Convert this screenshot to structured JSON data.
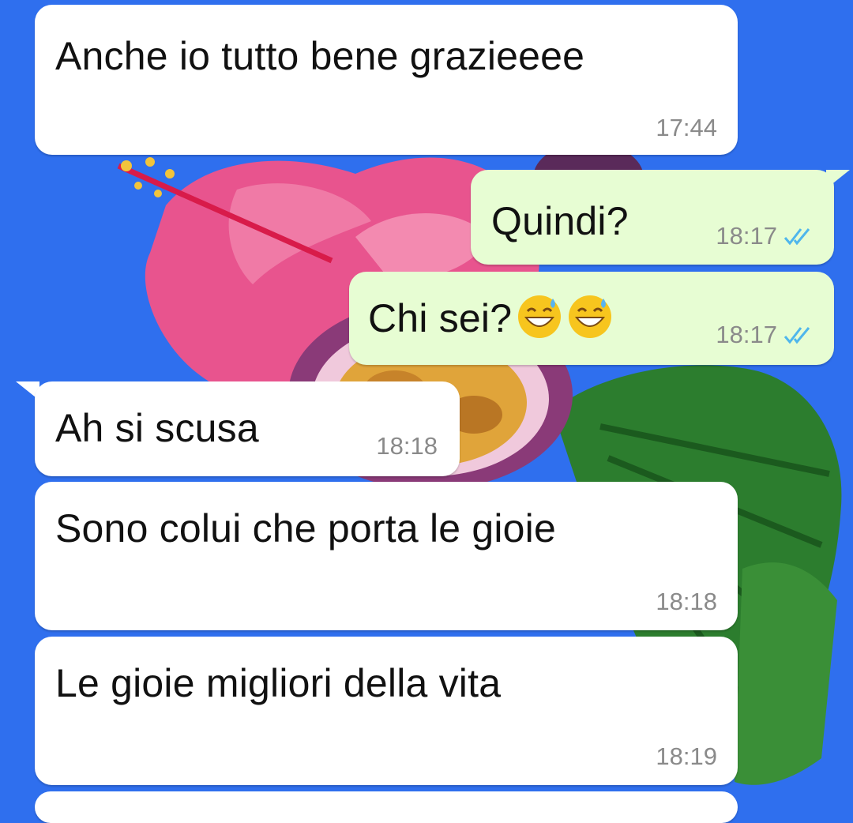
{
  "colors": {
    "wallpaper": "#2f6fee",
    "incoming_bubble": "#ffffff",
    "outgoing_bubble": "#e7fdd3",
    "read_tick": "#4fb6ec",
    "timestamp": "#8a8a8a"
  },
  "messages": [
    {
      "direction": "incoming",
      "text": "Anche io tutto bene grazieeee",
      "time": "17:44"
    },
    {
      "direction": "outgoing",
      "text": "Quindi?",
      "time": "18:17",
      "status": "read",
      "status_icon": "double-check-icon"
    },
    {
      "direction": "outgoing",
      "text": "Chi sei?",
      "emoji": [
        "grinning-sweat-emoji",
        "grinning-sweat-emoji"
      ],
      "time": "18:17",
      "status": "read",
      "status_icon": "double-check-icon"
    },
    {
      "direction": "incoming",
      "text": "Ah si scusa",
      "time": "18:18"
    },
    {
      "direction": "incoming",
      "text": "Sono colui che porta le gioie",
      "time": "18:18"
    },
    {
      "direction": "incoming",
      "text": "Le gioie migliori della vita",
      "time": "18:19"
    }
  ]
}
